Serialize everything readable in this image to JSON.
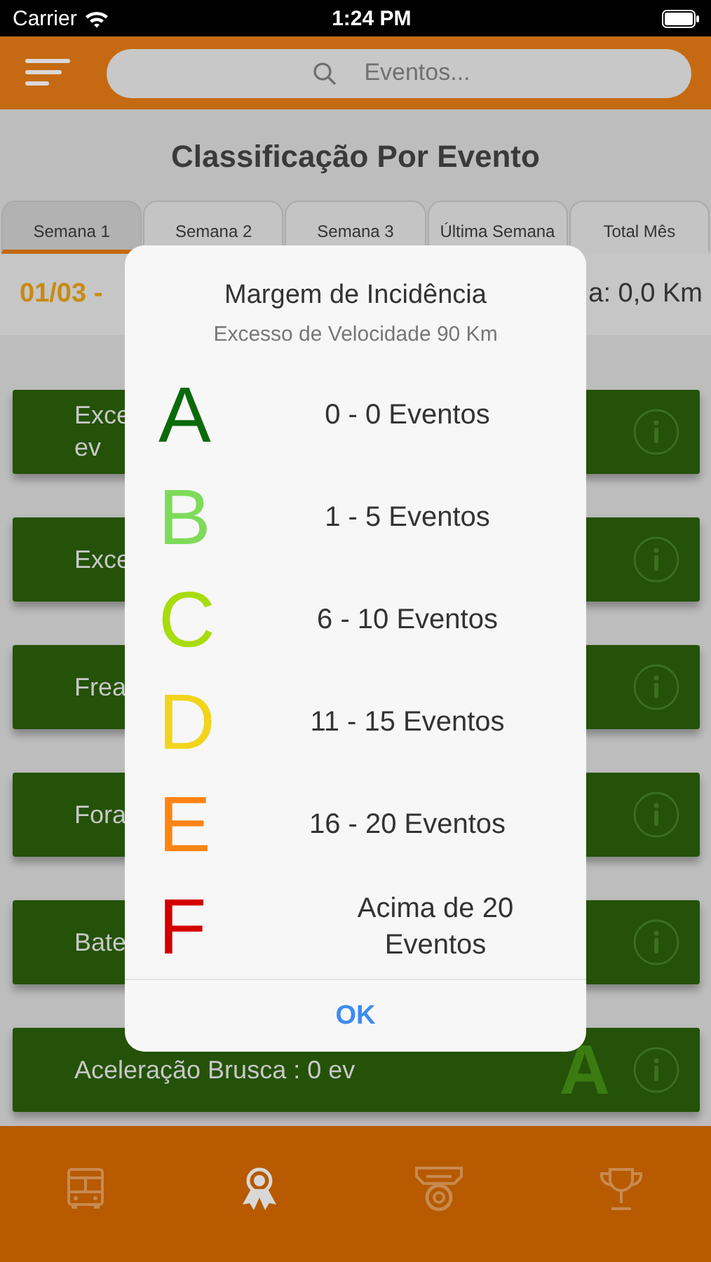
{
  "status_bar": {
    "carrier": "Carrier",
    "time": "1:24 PM"
  },
  "search": {
    "placeholder": "Eventos..."
  },
  "title": "Classificação Por Evento",
  "tabs": [
    {
      "label": "Semana 1",
      "selected": true
    },
    {
      "label": "Semana 2",
      "selected": false
    },
    {
      "label": "Semana 3",
      "selected": false
    },
    {
      "label": "Última Semana",
      "selected": false
    },
    {
      "label": "Total Mês",
      "selected": false
    }
  ],
  "period": {
    "dates": "01/03 -",
    "distance": "a: 0,0 Km"
  },
  "events": [
    {
      "lines": [
        "Exce",
        "ev"
      ]
    },
    {
      "lines": [
        "Exce"
      ]
    },
    {
      "lines": [
        "Frea"
      ]
    },
    {
      "lines": [
        "Fora"
      ]
    },
    {
      "lines": [
        "Bate"
      ]
    },
    {
      "lines": [
        "Aceleração Brusca : 0 ev"
      ],
      "grade": "A"
    }
  ],
  "bottom_nav": [
    {
      "kind": "bus",
      "selected": false
    },
    {
      "kind": "award",
      "selected": true
    },
    {
      "kind": "medal",
      "selected": false
    },
    {
      "kind": "trophy",
      "selected": false
    }
  ],
  "dialog": {
    "title": "Margem de Incidência",
    "subtitle": "Excesso de Velocidade 90 Km",
    "grades": [
      {
        "letter": "A",
        "range": "0 - 0 Eventos",
        "color": "#0a6a0a"
      },
      {
        "letter": "B",
        "range": "1 - 5 Eventos",
        "color": "#7edb5a"
      },
      {
        "letter": "C",
        "range": "6 - 10 Eventos",
        "color": "#a8dc0c"
      },
      {
        "letter": "D",
        "range": "11 - 15 Eventos",
        "color": "#f2d41c"
      },
      {
        "letter": "E",
        "range": "16 - 20 Eventos",
        "color": "#ff8412"
      },
      {
        "letter": "F",
        "range": "Acima de 20 Eventos",
        "color": "#d40000"
      }
    ],
    "button": "OK"
  }
}
